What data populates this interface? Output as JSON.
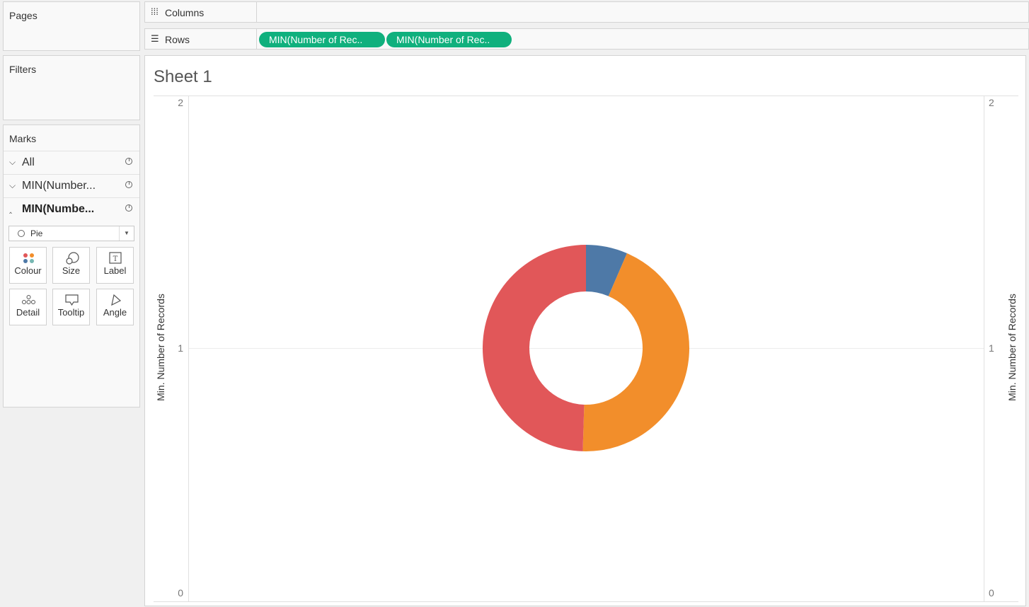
{
  "shelves": {
    "pages_label": "Pages",
    "filters_label": "Filters",
    "columns_label": "Columns",
    "rows_label": "Rows",
    "columns_icon": "bar-columns-icon",
    "rows_icon": "list-rows-icon",
    "row_pills": [
      "MIN(Number of Rec..",
      "MIN(Number of Rec.."
    ],
    "pill_color": "#10b07d"
  },
  "marks": {
    "title": "Marks",
    "cards_rows": [
      {
        "label": "All",
        "expanded": false
      },
      {
        "label": "MIN(Number...",
        "expanded": false
      },
      {
        "label": "MIN(Numbe...",
        "expanded": true
      }
    ],
    "mark_type": "Pie",
    "cards": [
      "Colour",
      "Size",
      "Label",
      "Detail",
      "Tooltip",
      "Angle"
    ]
  },
  "sheet": {
    "title": "Sheet 1"
  },
  "chart_data": {
    "type": "pie",
    "style": "donut",
    "slices": [
      {
        "value": 0.065,
        "color": "#4e79a7"
      },
      {
        "value": 0.44,
        "color": "#f28e2b"
      },
      {
        "value": 0.495,
        "color": "#e15759"
      }
    ],
    "ylabel_left": "Min. Number of Records",
    "ylabel_right": "Min. Number of Records",
    "yticks_left": [
      "2",
      "1",
      "0"
    ],
    "yticks_right": [
      "2",
      "1",
      "0"
    ],
    "ylim": [
      0,
      2
    ]
  }
}
